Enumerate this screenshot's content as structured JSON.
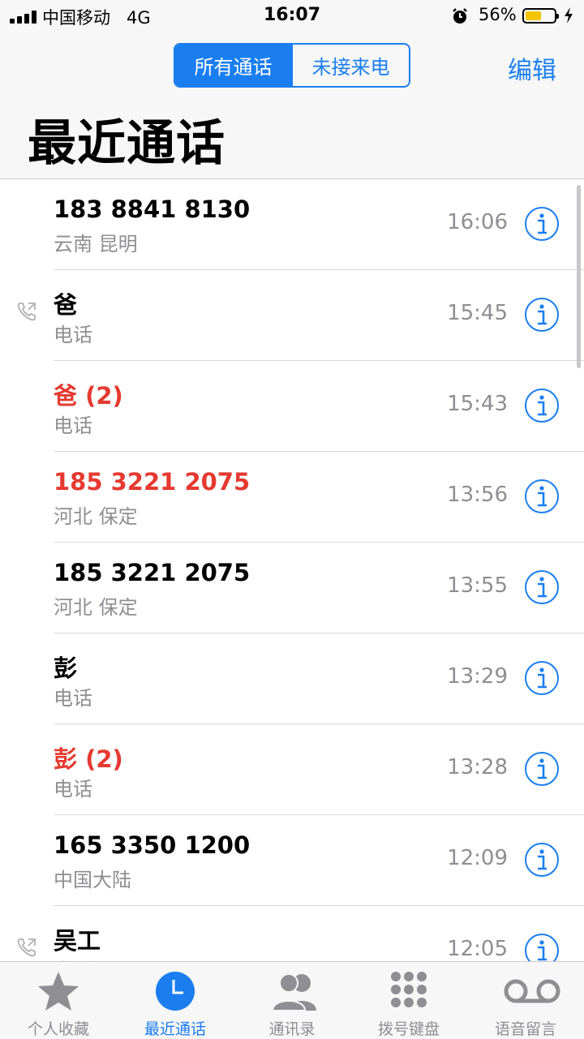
{
  "status_bar": {
    "carrier": "中国移动",
    "network": "4G",
    "time": "16:07",
    "battery_percent": "56%",
    "battery_level": 0.56
  },
  "nav": {
    "segments": [
      "所有通话",
      "未接来电"
    ],
    "active_segment": 0,
    "edit_label": "编辑",
    "title": "最近通话"
  },
  "calls": [
    {
      "name": "183 8841 8130",
      "subtitle": "云南 昆明",
      "time": "16:06",
      "missed": false,
      "outgoing": false
    },
    {
      "name": "爸",
      "subtitle": "电话",
      "time": "15:45",
      "missed": false,
      "outgoing": true
    },
    {
      "name": "爸 (2)",
      "subtitle": "电话",
      "time": "15:43",
      "missed": true,
      "outgoing": false
    },
    {
      "name": "185 3221 2075",
      "subtitle": "河北 保定",
      "time": "13:56",
      "missed": true,
      "outgoing": false
    },
    {
      "name": "185 3221 2075",
      "subtitle": "河北 保定",
      "time": "13:55",
      "missed": false,
      "outgoing": false
    },
    {
      "name": "彭",
      "subtitle": "电话",
      "time": "13:29",
      "missed": false,
      "outgoing": false
    },
    {
      "name": "彭 (2)",
      "subtitle": "电话",
      "time": "13:28",
      "missed": true,
      "outgoing": false
    },
    {
      "name": "165 3350 1200",
      "subtitle": "中国大陆",
      "time": "12:09",
      "missed": false,
      "outgoing": false
    },
    {
      "name": "吴工",
      "subtitle": "电话",
      "time": "12:05",
      "missed": false,
      "outgoing": true
    }
  ],
  "tabs": [
    {
      "label": "个人收藏",
      "icon": "star-icon"
    },
    {
      "label": "最近通话",
      "icon": "clock-icon"
    },
    {
      "label": "通讯录",
      "icon": "contacts-icon"
    },
    {
      "label": "拨号键盘",
      "icon": "keypad-icon"
    },
    {
      "label": "语音留言",
      "icon": "voicemail-icon"
    }
  ],
  "active_tab": 1,
  "colors": {
    "accent": "#1a7ef0",
    "missed": "#e53a31",
    "secondary_text": "#8e8e93"
  }
}
